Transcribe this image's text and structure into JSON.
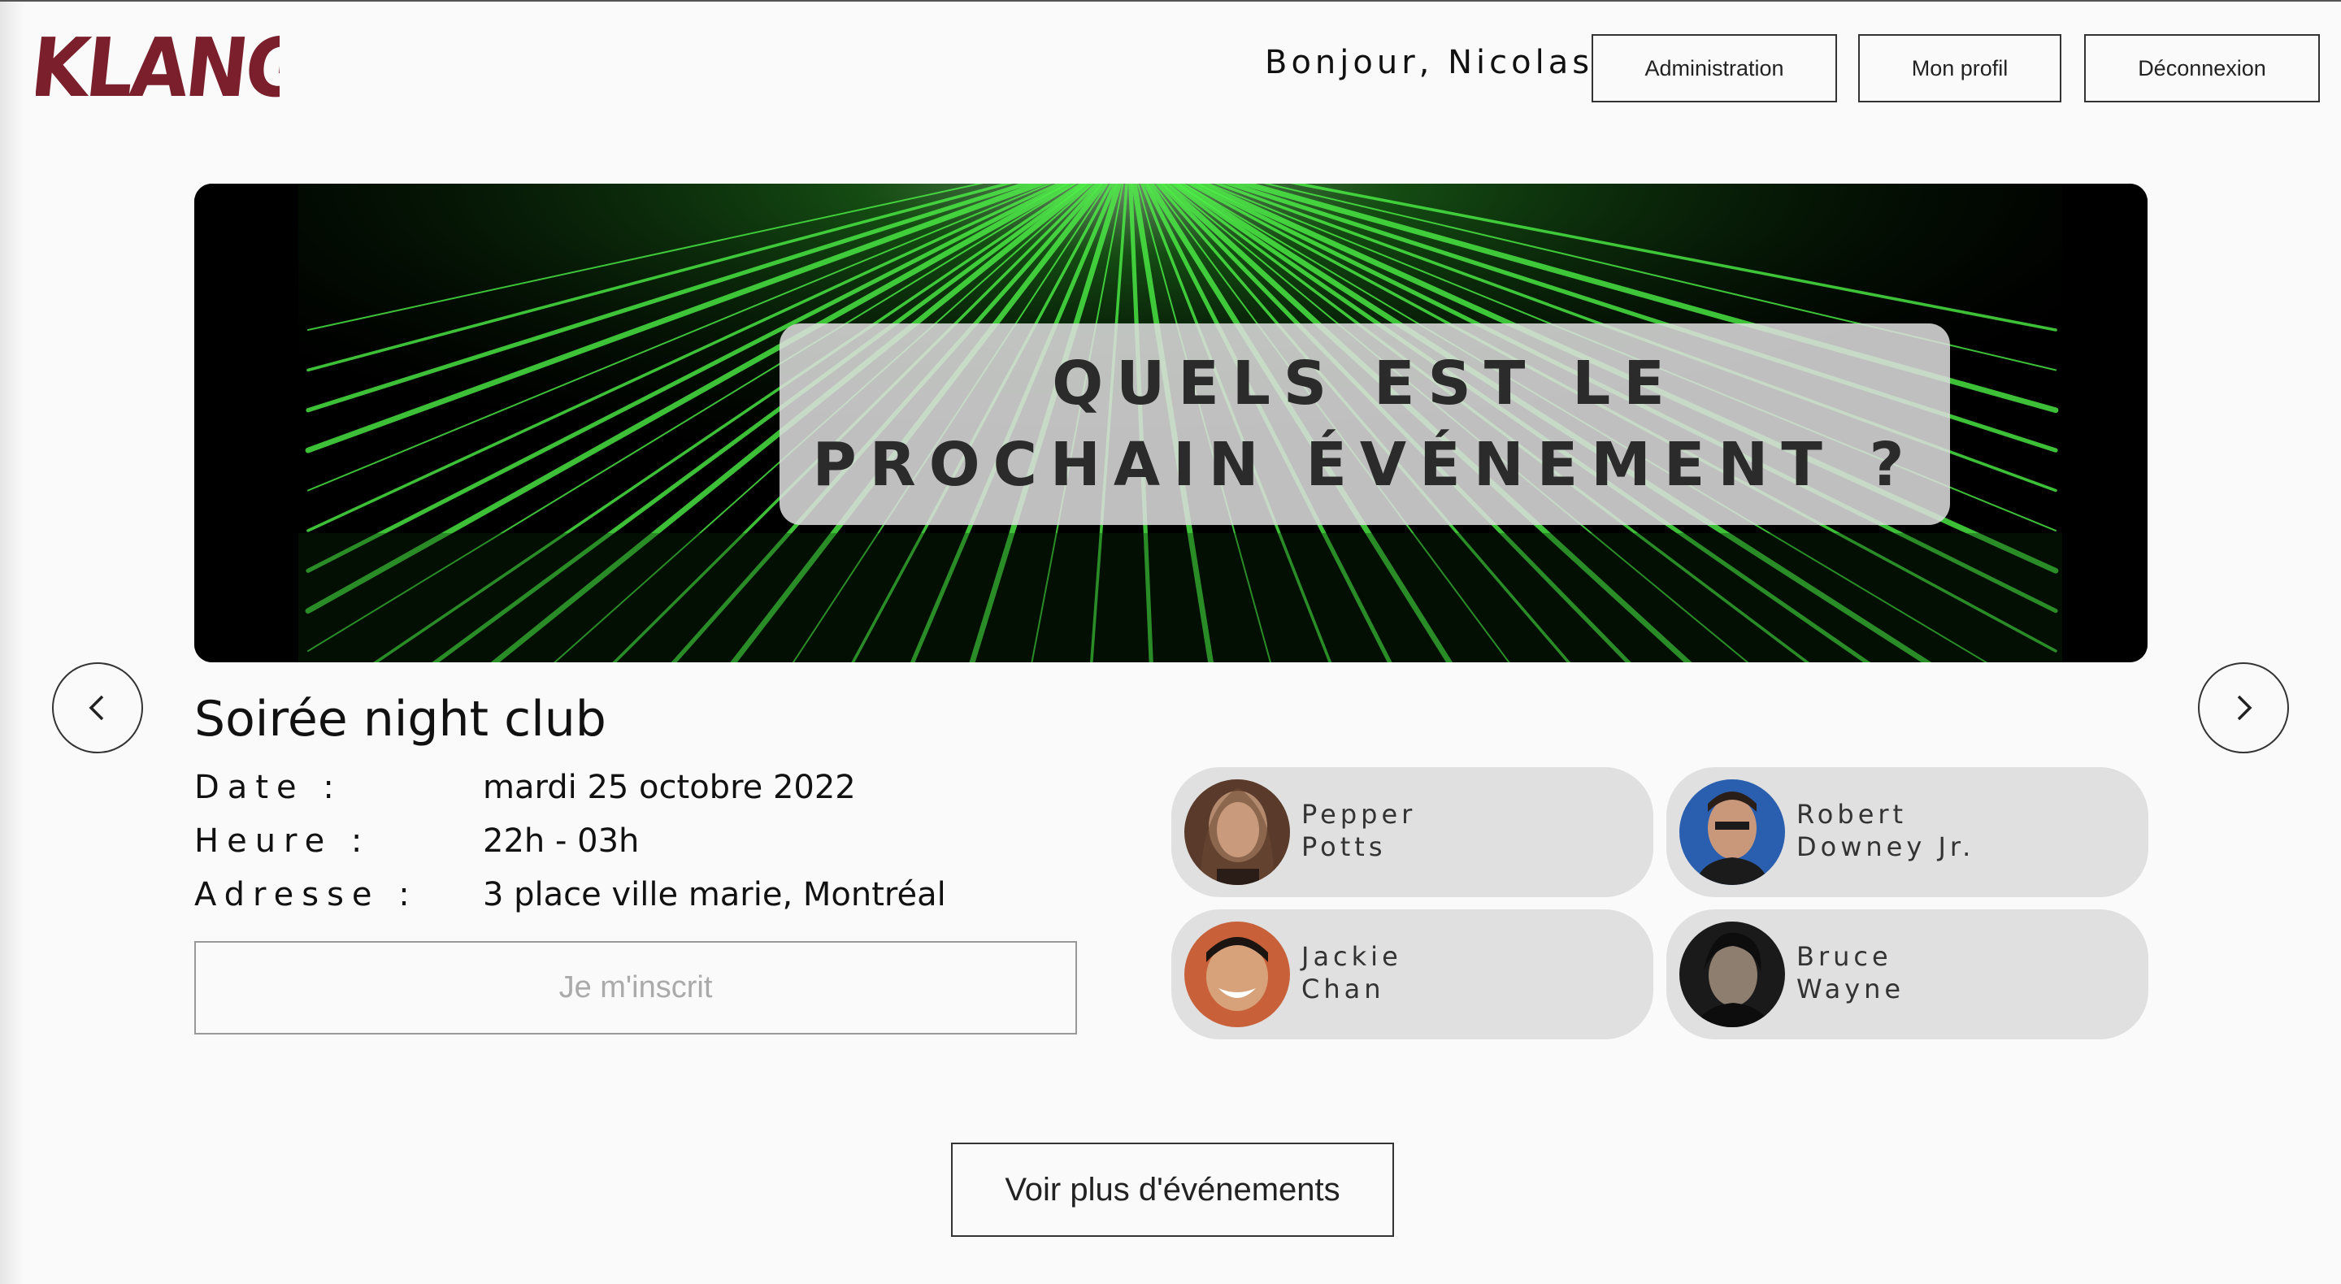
{
  "header": {
    "logo_text": "KLANG",
    "greeting": "Bonjour, Nicolas",
    "admin_label": "Administration",
    "profile_label": "Mon profil",
    "logout_label": "Déconnexion"
  },
  "hero": {
    "line1": "QUELS EST LE",
    "line2": "PROCHAIN ÉVÉNEMENT ?"
  },
  "event": {
    "title": "Soirée night club",
    "date_label": "Date :",
    "date_value": "mardi 25 octobre 2022",
    "time_label": "Heure :",
    "time_value": "22h - 03h",
    "address_label": "Adresse :",
    "address_value": "3 place ville marie, Montréal",
    "signup_label": "Je m'inscrit"
  },
  "artists": [
    {
      "first": "Pepper",
      "last": "Potts"
    },
    {
      "first": "Robert",
      "last": "Downey Jr."
    },
    {
      "first": "Jackie",
      "last": "Chan"
    },
    {
      "first": "Bruce",
      "last": "Wayne"
    }
  ],
  "more_label": "Voir plus d'événements",
  "colors": {
    "logo": "#7a1f2b",
    "laser": "#39d63a",
    "pill": "#e0e0e0"
  }
}
